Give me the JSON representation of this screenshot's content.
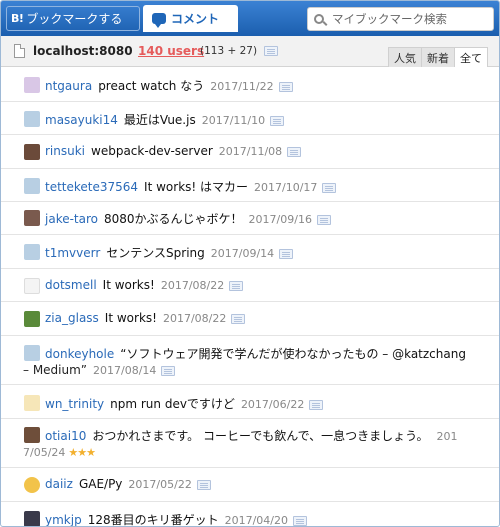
{
  "header": {
    "bookmark_logo": "B!",
    "bookmark_label": "ブックマークする",
    "comment_label": "コメント",
    "search_placeholder": "マイブックマーク検索"
  },
  "subbar": {
    "host": "localhost:8080",
    "users_link": "140 users",
    "users_count": "(113 + 27)",
    "tabs": [
      "人気",
      "新着",
      "全て"
    ]
  },
  "colors": {
    "header_blue": "#1f66b8",
    "users_red": "#e55b5b",
    "username_blue": "#2a6ab8",
    "star_yellow": "#f2b02e"
  },
  "comments": [
    {
      "user": "ntgaura",
      "text": "preact watch なう",
      "date": "2017/11/22"
    },
    {
      "user": "masayuki14",
      "text": "最近はVue.js",
      "date": "2017/11/10"
    },
    {
      "user": "rinsuki",
      "text": "webpack-dev-server",
      "date": "2017/11/08"
    },
    {
      "user": "tettekete37564",
      "text": "It works! はマカー",
      "date": "2017/10/17"
    },
    {
      "user": "jake-taro",
      "text": "8080かぶるんじゃボケ！",
      "date": "2017/09/16"
    },
    {
      "user": "t1mvverr",
      "text": "センテンスSpring",
      "date": "2017/09/14"
    },
    {
      "user": "dotsmell",
      "text": "It works!",
      "date": "2017/08/22"
    },
    {
      "user": "zia_glass",
      "text": "It works!",
      "date": "2017/08/22"
    },
    {
      "user": "donkeyhole",
      "text": "“ソフトウェア開発で学んだが使わなかったもの – @katzchang",
      "text2": "– Medium”",
      "date": "2017/08/14"
    },
    {
      "user": "wn_trinity",
      "text": "npm run devですけど",
      "date": "2017/06/22"
    },
    {
      "user": "otiai10",
      "text": "おつかれさまです。 コーヒーでも飲んで、一息つきましょう。",
      "date_part1": "201",
      "date_part2": "7/05/24",
      "stars": "★★★"
    },
    {
      "user": "daiiz",
      "text": "GAE/Py",
      "date": "2017/05/22"
    },
    {
      "user": "ymkjp",
      "text": "128番目のキリ番ゲット",
      "date": "2017/04/20"
    }
  ]
}
